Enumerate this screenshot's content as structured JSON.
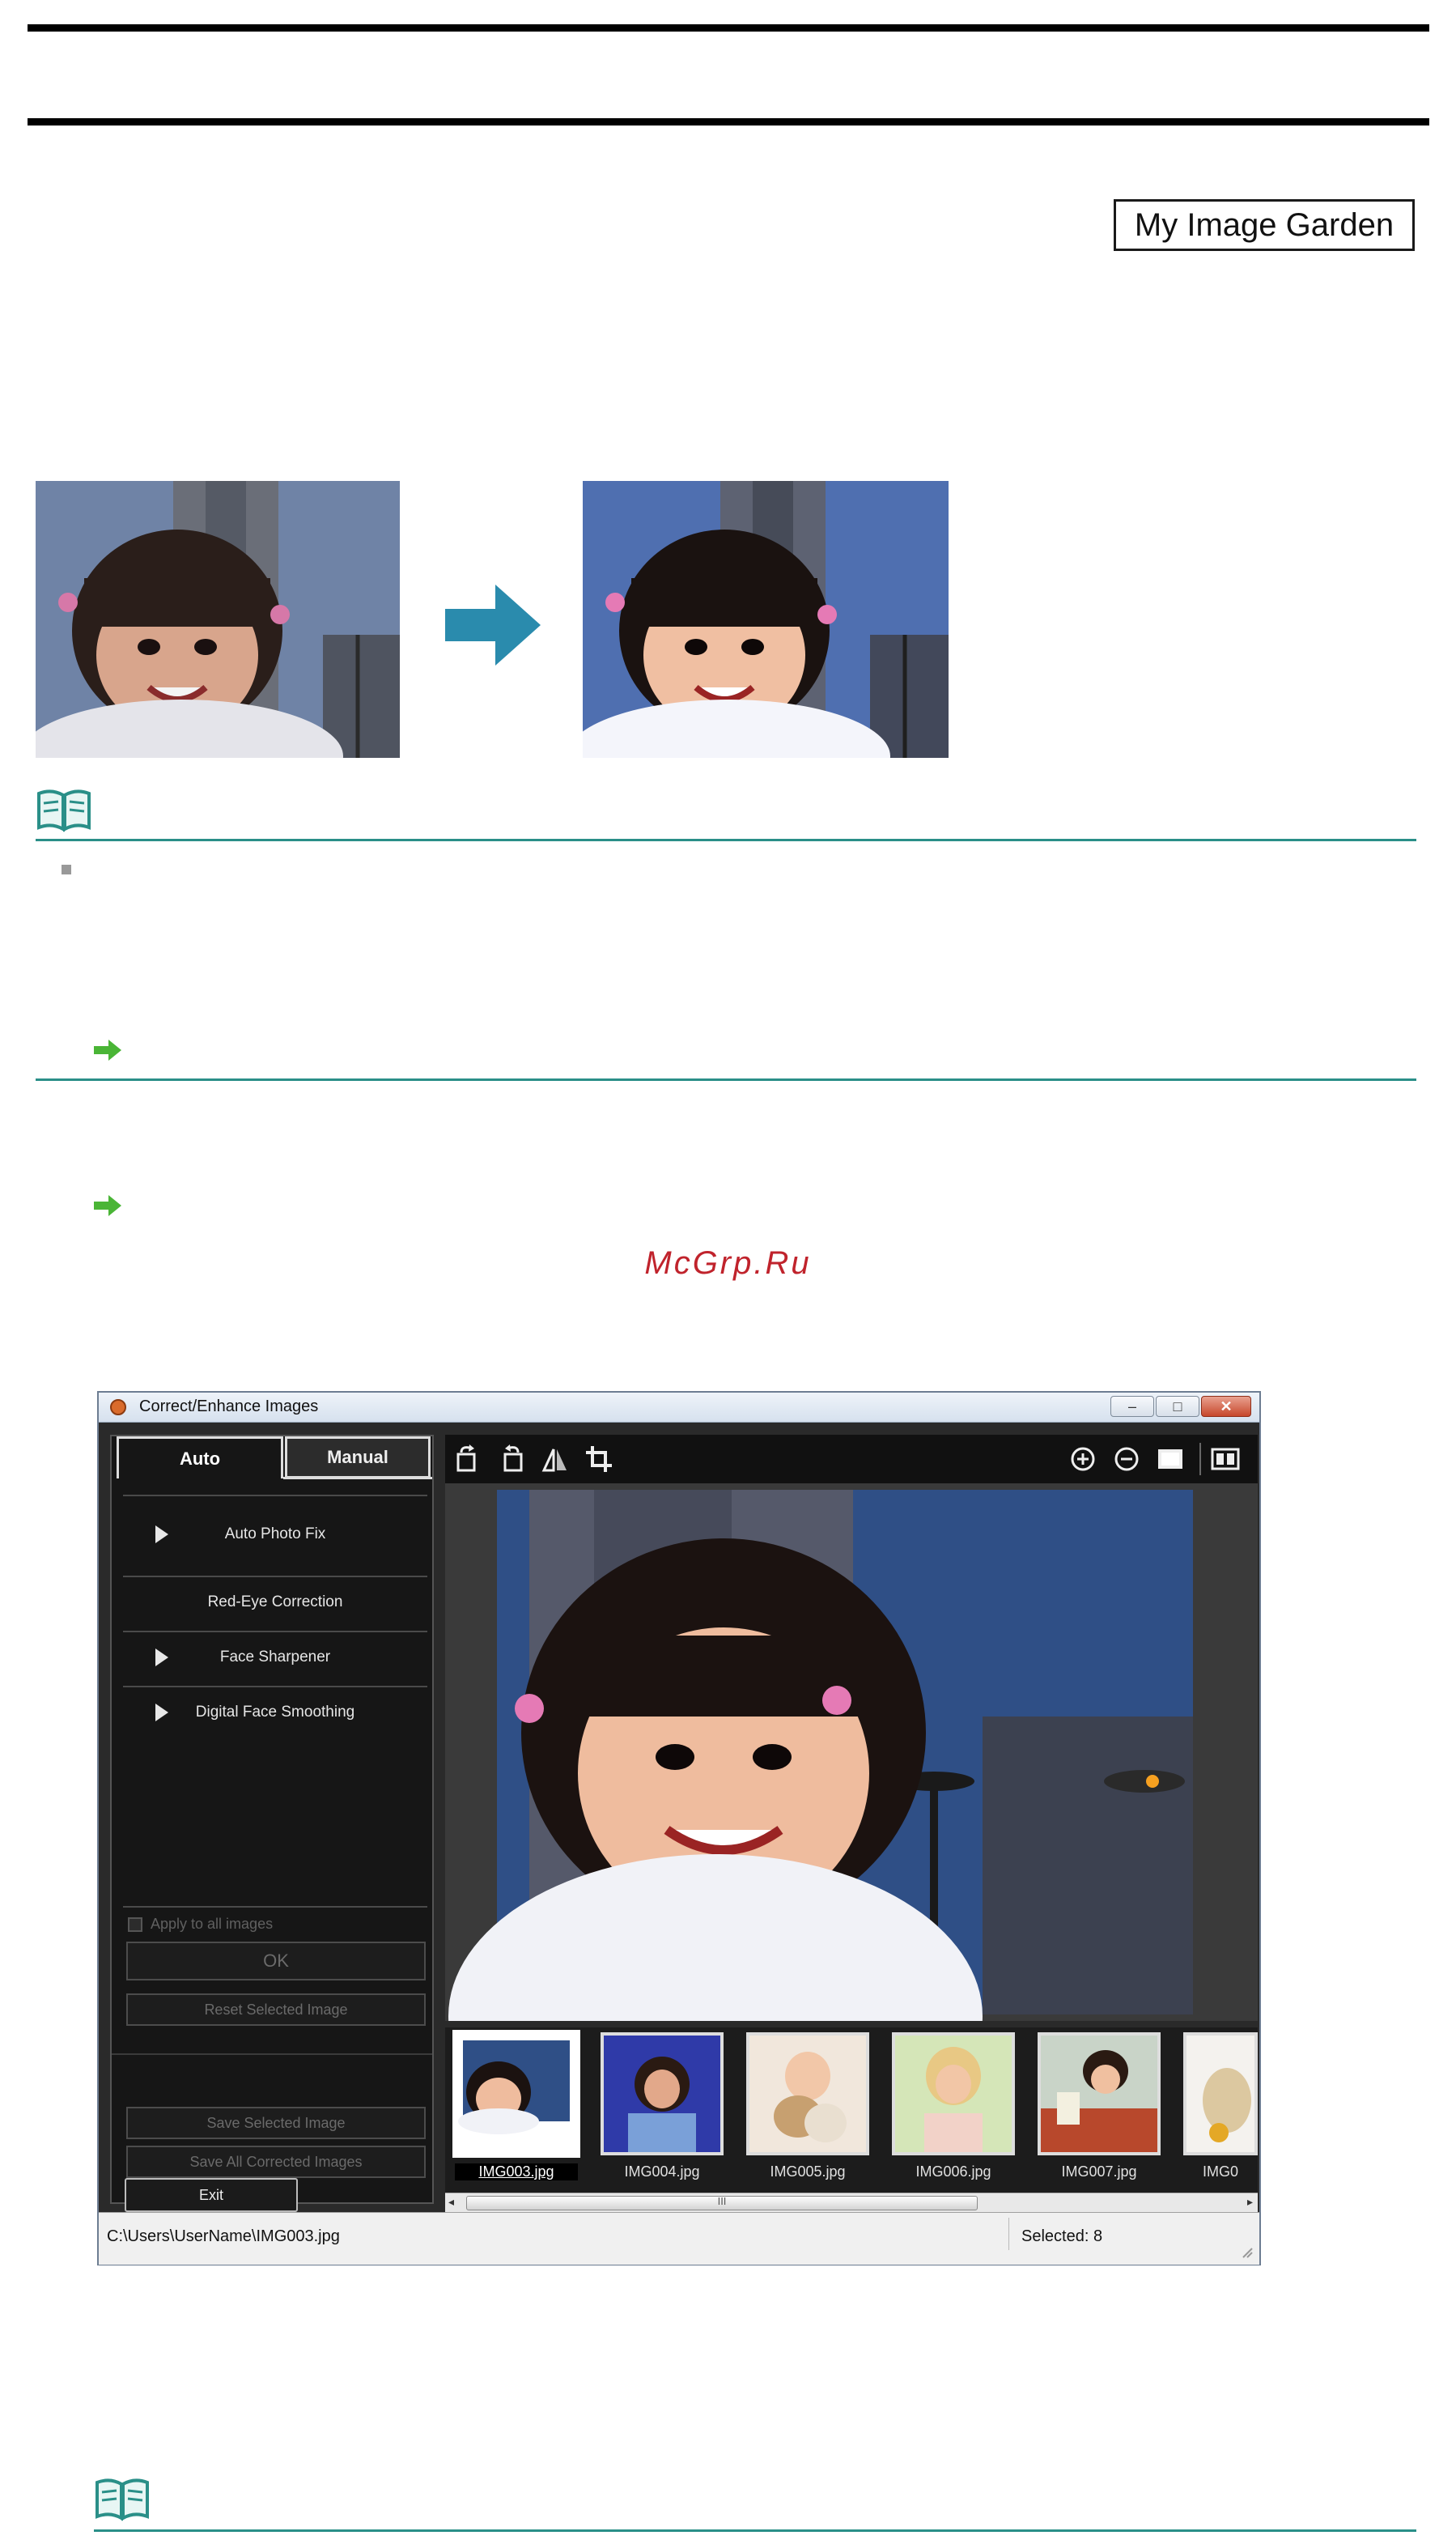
{
  "header": {
    "badge_label": "My Image Garden"
  },
  "watermark": "McGrp.Ru",
  "window": {
    "title": "Correct/Enhance Images",
    "tabs": {
      "auto": "Auto",
      "manual": "Manual"
    },
    "menu": {
      "auto_photo_fix": "Auto Photo Fix",
      "red_eye": "Red-Eye Correction",
      "face_sharpener": "Face Sharpener",
      "digital_face_smoothing": "Digital Face Smoothing"
    },
    "apply_all": "Apply to all images",
    "ok": "OK",
    "reset": "Reset Selected Image",
    "save_selected": "Save Selected Image",
    "save_all": "Save All Corrected Images",
    "exit": "Exit",
    "thumbnails": [
      "IMG003.jpg",
      "IMG004.jpg",
      "IMG005.jpg",
      "IMG006.jpg",
      "IMG007.jpg",
      "IMG0"
    ],
    "scroll_grip": "III",
    "status_path": "C:\\Users\\UserName\\IMG003.jpg",
    "status_selected": "Selected: 8"
  },
  "icons": [
    "book-note-icon",
    "green-arrow-icon",
    "right-arrow-icon",
    "rotate-left-icon",
    "rotate-right-icon",
    "flip-icon",
    "crop-icon",
    "zoom-in-icon",
    "zoom-out-icon",
    "full-view-icon",
    "compare-icon"
  ]
}
